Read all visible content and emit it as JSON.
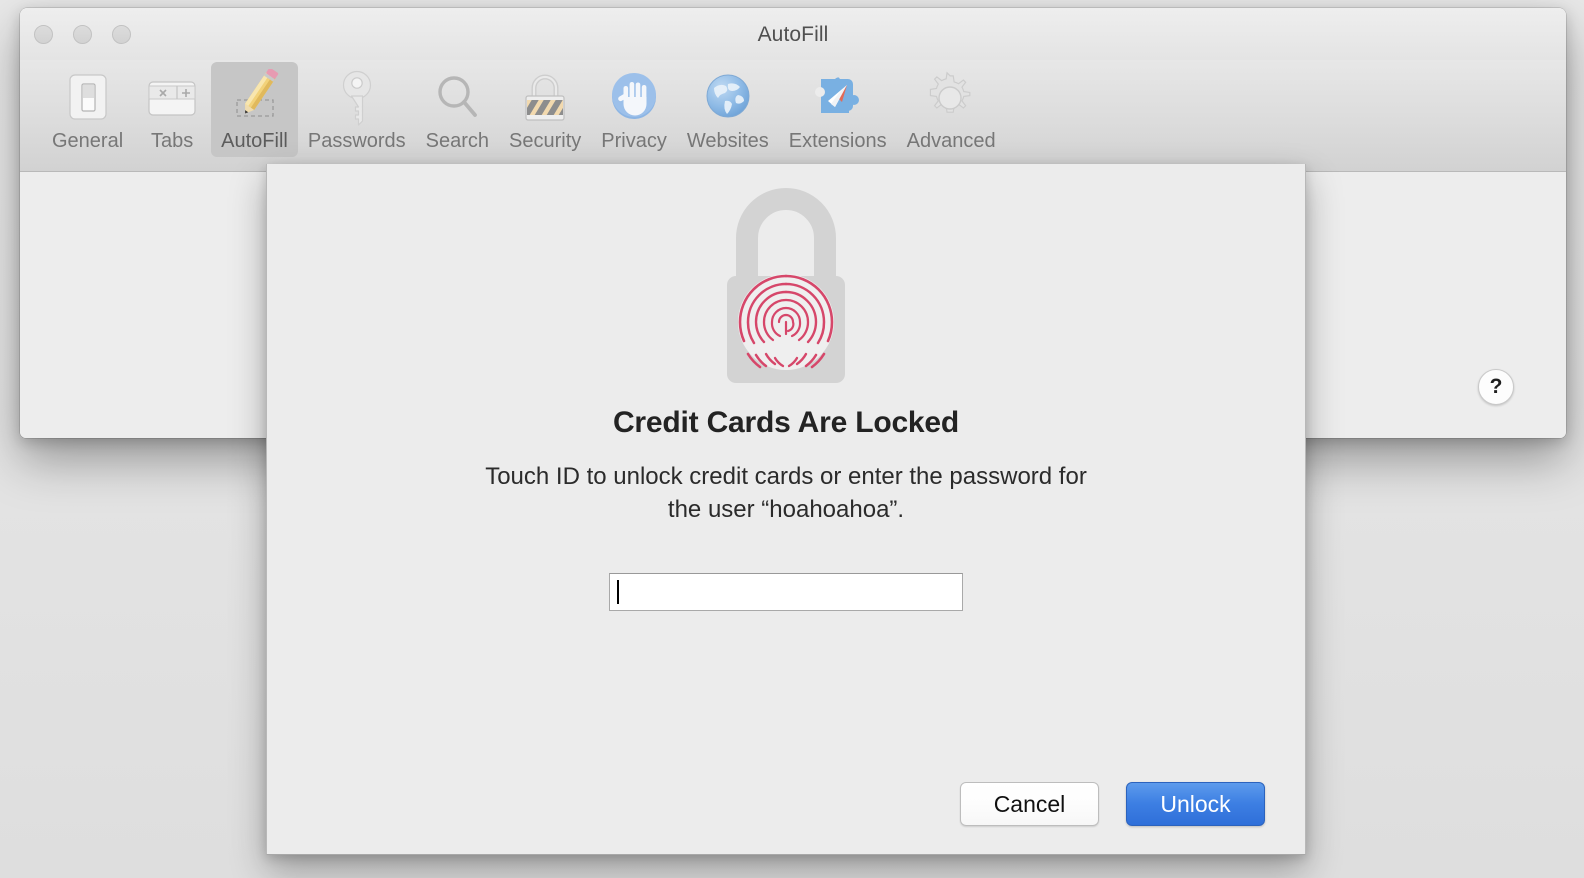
{
  "window": {
    "title": "AutoFill",
    "traffic_lights": [
      "close",
      "minimize",
      "zoom"
    ]
  },
  "toolbar": {
    "items": [
      {
        "label": "General",
        "icon": "switch-icon",
        "selected": false
      },
      {
        "label": "Tabs",
        "icon": "tabs-icon",
        "selected": false
      },
      {
        "label": "AutoFill",
        "icon": "pencil-icon",
        "selected": true
      },
      {
        "label": "Passwords",
        "icon": "key-icon",
        "selected": false
      },
      {
        "label": "Search",
        "icon": "magnifier-icon",
        "selected": false
      },
      {
        "label": "Security",
        "icon": "padlock-icon",
        "selected": false
      },
      {
        "label": "Privacy",
        "icon": "hand-icon",
        "selected": false
      },
      {
        "label": "Websites",
        "icon": "globe-icon",
        "selected": false
      },
      {
        "label": "Extensions",
        "icon": "puzzle-compass-icon",
        "selected": false
      },
      {
        "label": "Advanced",
        "icon": "gear-icon",
        "selected": false
      }
    ]
  },
  "help": {
    "label": "?"
  },
  "sheet": {
    "icon": "lock-with-touchid-icon",
    "title": "Credit Cards Are Locked",
    "message": "Touch ID to unlock credit cards or enter the password for the user “hoahoahoa”.",
    "password": {
      "value": "",
      "placeholder": ""
    },
    "buttons": {
      "cancel": "Cancel",
      "unlock": "Unlock"
    }
  },
  "colors": {
    "accent_blue": "#3d7fe3",
    "fingerprint_red": "#d64060",
    "lock_gray": "#d2d2d2",
    "window_bg": "#ececec",
    "toolbar_selected": "#c6c6c6"
  }
}
